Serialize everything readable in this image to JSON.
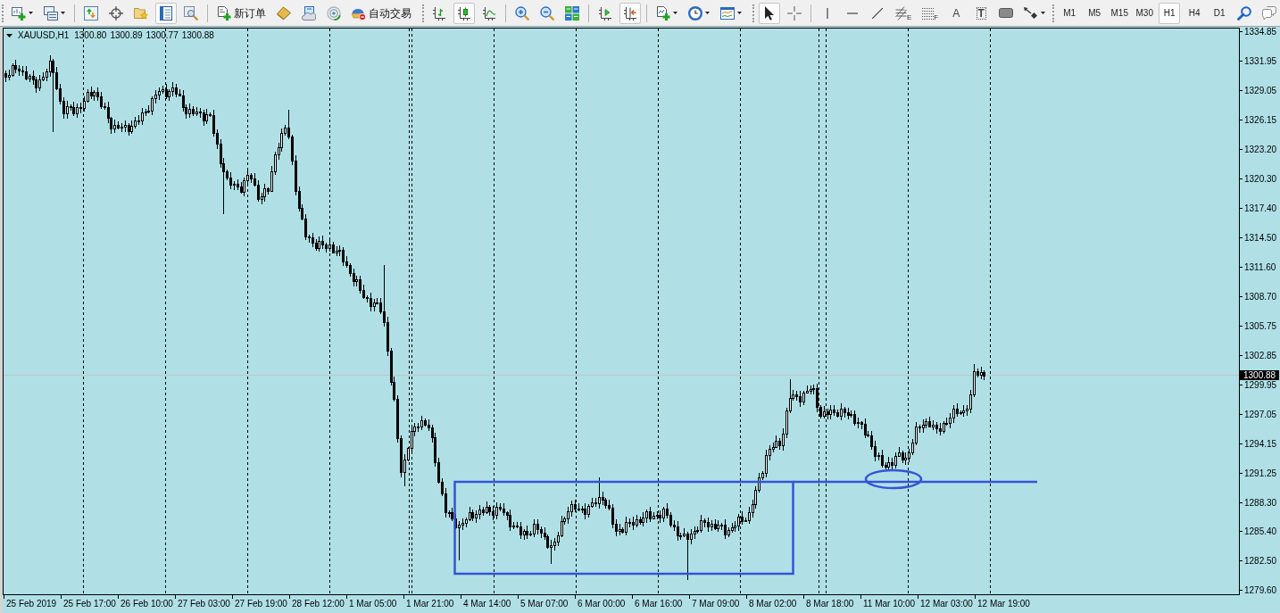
{
  "toolbars": [
    {
      "groups": [
        [
          {
            "kind": "icon",
            "pressed": false,
            "menu": true
          },
          {
            "kind": "icon",
            "pressed": false,
            "menu": true
          }
        ],
        [
          {
            "kind": "icon",
            "pressed": false
          },
          {
            "kind": "icon",
            "pressed": false
          },
          {
            "kind": "icon",
            "pressed": false
          },
          {
            "kind": "icon",
            "pressed": true
          },
          {
            "kind": "icon",
            "pressed": false
          }
        ],
        [
          {
            "kind": "labeled",
            "label": "新订单",
            "pressed": false
          },
          {
            "kind": "icon",
            "pressed": false
          },
          {
            "kind": "icon",
            "pressed": false
          },
          {
            "kind": "icon",
            "pressed": false
          },
          {
            "kind": "labeled",
            "label": "自动交易",
            "pressed": false
          }
        ]
      ]
    },
    {
      "groups": [
        [
          {
            "kind": "icon",
            "pressed": false
          },
          {
            "kind": "icon",
            "pressed": true
          },
          {
            "kind": "icon",
            "pressed": false
          }
        ],
        [
          {
            "kind": "icon",
            "pressed": false
          },
          {
            "kind": "icon",
            "pressed": false
          },
          {
            "kind": "icon",
            "pressed": false
          }
        ],
        [
          {
            "kind": "icon",
            "pressed": false
          },
          {
            "kind": "icon",
            "pressed": true
          }
        ],
        [
          {
            "kind": "icon",
            "pressed": false,
            "menu": true
          },
          {
            "kind": "icon",
            "pressed": false,
            "menu": true
          },
          {
            "kind": "icon",
            "pressed": false,
            "menu": true
          }
        ]
      ]
    },
    {
      "groups": [
        [
          {
            "kind": "icon",
            "pressed": true
          },
          {
            "kind": "icon",
            "pressed": false
          }
        ],
        [
          {
            "kind": "icon",
            "pressed": false
          },
          {
            "kind": "icon",
            "pressed": false
          },
          {
            "kind": "icon",
            "pressed": false
          },
          {
            "kind": "icon",
            "pressed": false,
            "sublabel": "E"
          },
          {
            "kind": "icon",
            "pressed": false,
            "sublabel": "F"
          },
          {
            "kind": "glyph",
            "glyph": "A",
            "pressed": false
          },
          {
            "kind": "glyph",
            "glyph": "T",
            "pressed": false
          },
          {
            "kind": "icon",
            "pressed": false
          },
          {
            "kind": "icon",
            "pressed": false,
            "menu": true
          }
        ]
      ]
    },
    {
      "groups": [
        [
          {
            "kind": "period",
            "label": "M1",
            "selected": false
          },
          {
            "kind": "period",
            "label": "M5",
            "selected": false
          },
          {
            "kind": "period",
            "label": "M15",
            "selected": false
          },
          {
            "kind": "period",
            "label": "M30",
            "selected": false
          },
          {
            "kind": "period",
            "label": "H1",
            "selected": true
          },
          {
            "kind": "period",
            "label": "H4",
            "selected": false
          },
          {
            "kind": "period",
            "label": "D1",
            "selected": false
          },
          {
            "kind": "icon",
            "pressed": false
          },
          {
            "kind": "icon",
            "pressed": false
          }
        ]
      ]
    }
  ],
  "chart": {
    "header": {
      "symbol": "XAUUSD,H1",
      "prices": [
        "1300.80",
        "1300.89",
        "1300.77",
        "1300.88"
      ]
    },
    "price_axis": {
      "ticks": [
        "1334.85",
        "1331.95",
        "1329.05",
        "1326.15",
        "1323.20",
        "1320.30",
        "1317.40",
        "1314.50",
        "1311.60",
        "1308.70",
        "1305.75",
        "1302.85",
        "1299.95",
        "1297.05",
        "1294.15",
        "1291.25",
        "1288.30",
        "1285.40",
        "1282.50",
        "1279.60"
      ],
      "current_price": "1300.88"
    },
    "time_axis": {
      "ticks": [
        "25 Feb 2019",
        "25 Feb 17:00",
        "26 Feb 10:00",
        "27 Feb 03:00",
        "27 Feb 19:00",
        "28 Feb 12:00",
        "1 Mar 05:00",
        "1 Mar 21:00",
        "4 Mar 14:00",
        "5 Mar 07:00",
        "6 Mar 00:00",
        "6 Mar 16:00",
        "7 Mar 09:00",
        "8 Mar 02:00",
        "8 Mar 18:00",
        "11 Mar 10:00",
        "12 Mar 03:00",
        "12 Mar 19:00"
      ]
    }
  }
}
